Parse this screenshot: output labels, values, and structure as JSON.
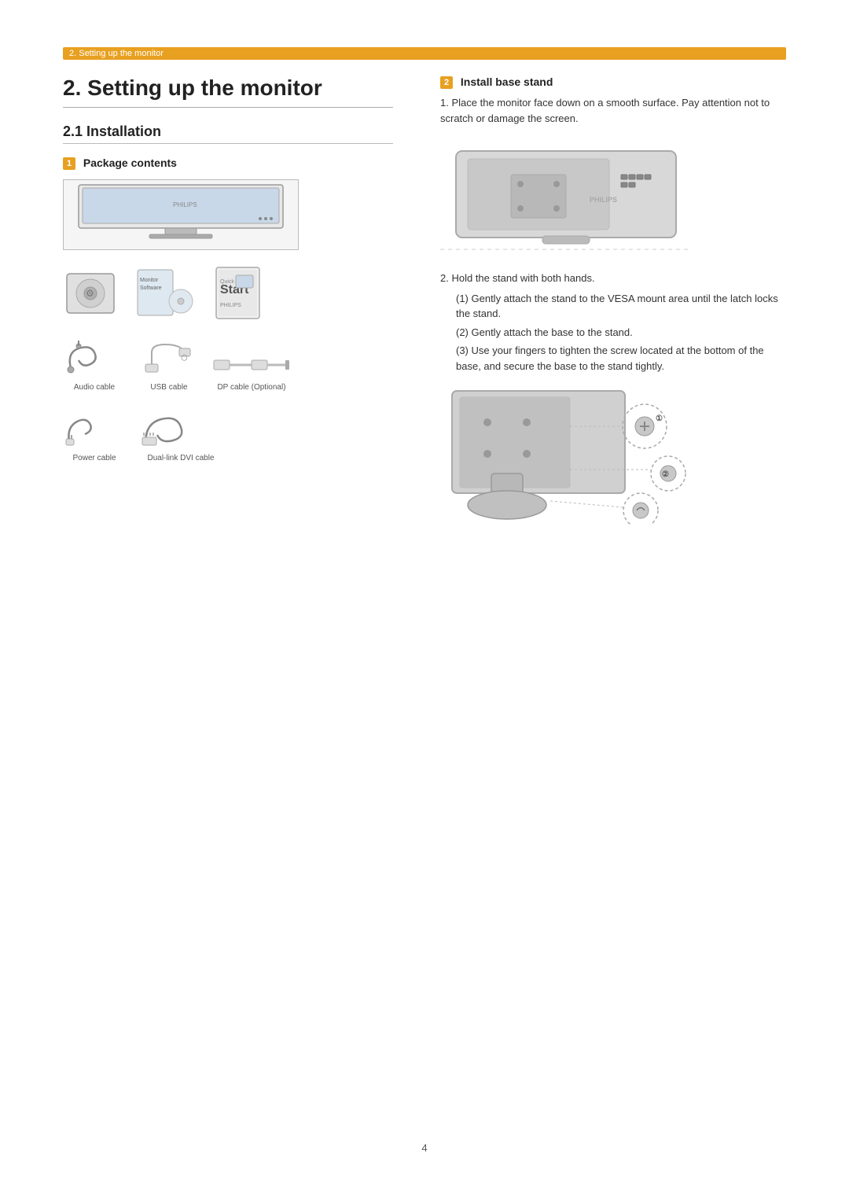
{
  "breadcrumb": "2. Setting up the monitor",
  "section_number": "2.",
  "section_title": "Setting up the monitor",
  "subsection": "2.1  Installation",
  "step1": {
    "badge": "1",
    "title": "Package contents"
  },
  "step2": {
    "badge": "2",
    "title": "Install base stand",
    "instruction1": "Place the monitor face down on a smooth surface. Pay attention not to scratch or damage the screen.",
    "instruction2": "Hold the stand with both hands.",
    "sub1": "(1) Gently attach the stand to the VESA mount area until the latch locks the stand.",
    "sub2": "(2) Gently attach the base to the stand.",
    "sub3": "(3) Use your fingers to tighten the screw located at the bottom of the base, and secure the base to the stand tightly."
  },
  "cables": {
    "audio": "Audio cable",
    "usb": "USB cable",
    "dp": "DP cable (Optional)",
    "power": "Power cable",
    "dvi": "Dual-link DVI cable"
  },
  "page_number": "4"
}
